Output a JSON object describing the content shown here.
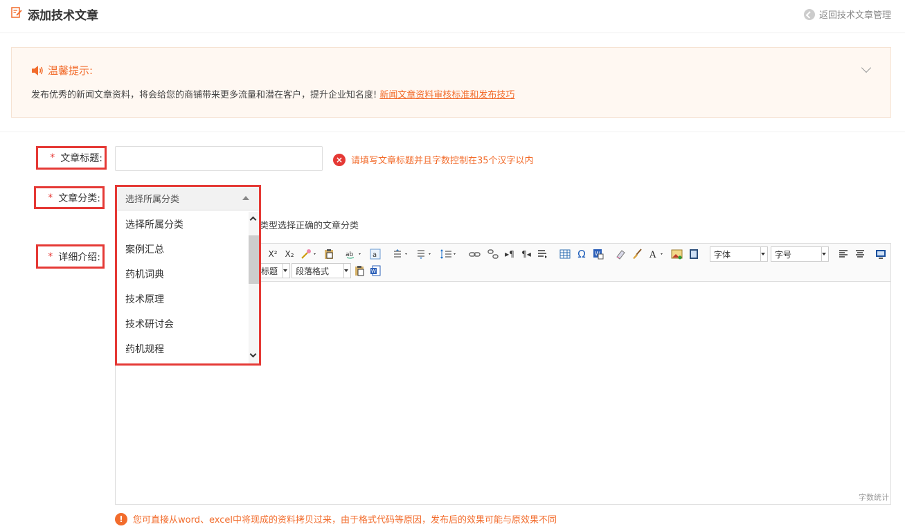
{
  "header": {
    "title": "添加技术文章",
    "back_label": "返回技术文章管理"
  },
  "tips": {
    "heading": "温馨提示:",
    "text": "发布优秀的新闻文章资料，将会给您的商铺带来更多流量和潜在客户，提升企业知名度!",
    "link": "新闻文章资料审核标准和发布技巧"
  },
  "form": {
    "required_mark": "*",
    "title_label": "文章标题:",
    "title_error": "请填写文章标题并且字数控制在35个汉字以内",
    "category_label": "文章分类:",
    "category_hint": "类型选择正确的文章分类",
    "detail_label": "详细介绍:"
  },
  "dropdown": {
    "selected": "选择所属分类",
    "options": [
      "选择所属分类",
      "案例汇总",
      "药机词典",
      "技术原理",
      "技术研讨会",
      "药机规程"
    ]
  },
  "editor": {
    "font_select": "字体",
    "size_select": "字号",
    "heading_select": "标题",
    "paragraph_select": "段落格式",
    "word_count": "字数统计",
    "note": "您可直接从word、excel中将现成的资料拷贝过来，由于格式代码等原因，发布后的效果可能与原效果不同"
  },
  "colors": {
    "accent": "#f26c2c",
    "highlight_border": "#e53935",
    "error": "#e53935"
  }
}
